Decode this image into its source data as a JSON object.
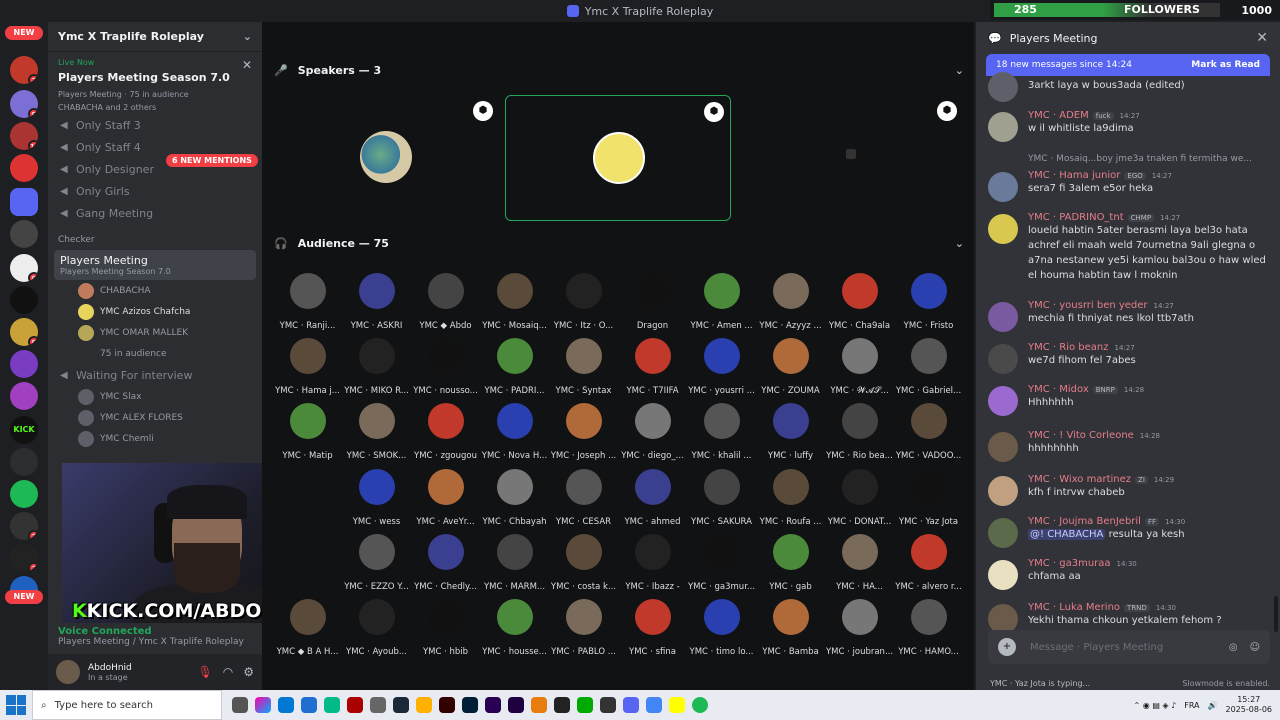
{
  "window": {
    "title": "Ymc X Traplife Roleplay"
  },
  "followers": {
    "count": "285",
    "label": "FOLLOWERS",
    "goal": "1000"
  },
  "servers": {
    "new_top": "NEW",
    "new_bottom": "NEW",
    "badges": [
      "3",
      "5",
      "11",
      "5",
      "5",
      "2",
      "3",
      "2"
    ]
  },
  "sidebar": {
    "server_name": "Ymc X Traplife Roleplay",
    "live_now": "Live Now",
    "live_title": "Players Meeting Season 7.0",
    "live_sub1": "Players Meeting · 75 in audience",
    "live_sub2": "CHABACHA and 2 others",
    "mentions": "6 NEW MENTIONS",
    "channels": [
      "Only Staff 3",
      "Only Staff 4",
      "Only Designer",
      "Only Girls",
      "Gang Meeting"
    ],
    "category": "Checker",
    "stage_name": "Players Meeting",
    "stage_sub": "Players Meeting Season 7.0",
    "stage_members": [
      "CHABACHA",
      "YMC Azizos Chafcha",
      "YMC OMAR MALLEK",
      "75 in audience"
    ],
    "waiting": "Waiting For interview",
    "waiting_members": [
      "YMC Slax",
      "YMC ALEX FLORES",
      "YMC Chemli"
    ],
    "voice_connected": "Voice Connected",
    "voice_sub": "Players Meeting / Ymc X Traplife Roleplay",
    "user": "AbdoHnid",
    "user_status": "In a stage"
  },
  "stream": {
    "kick_prefix": "K",
    "kick_url": "KICK.COM/ABDOHNID"
  },
  "stage": {
    "speakers_header": "Speakers — 3",
    "speakers_colors": [
      "#c07a5c",
      "#3b3d31",
      "#b5a658"
    ],
    "audience_header": "Audience — 75",
    "audience": [
      [
        "YMC · Ranji...",
        "YMC · ASKRI",
        "YMC ◆ Abdo",
        "YMC · Mosaiq...",
        "YMC · Itz · O...",
        "Dragon",
        "YMC · Amen ...",
        "YMC · Azyyz ...",
        "YMC · Cha9ala",
        "YMC · Fristo"
      ],
      [
        "YMC · Hama j...",
        "YMC · MIKO R...",
        "YMC · nousso...",
        "YMC · PADRI...",
        "YMC · Syntax",
        "YMC · T7IIFA",
        "YMC · yousrri ...",
        "YMC · ZOUMA",
        "YMC · 𝓦𝓐𝓢...",
        "YMC · Gabriel..."
      ],
      [
        "YMC · Matip",
        "YMC · SMOK...",
        "YMC · zgougou",
        "YMC · Nova H...",
        "YMC · Joseph ...",
        "YMC · diego_...",
        "YMC · khalil ...",
        "YMC · luffy",
        "YMC · Rio bea...",
        "YMC · VADOO..."
      ],
      [
        "YMC · wess",
        "YMC · AveYr...",
        "YMC · Chbayah",
        "YMC · CESAR",
        "YMC · ahmed",
        "YMC · SAKURA",
        "YMC · Roufa ...",
        "YMC · DONAT...",
        "YMC · Yaz Jota"
      ],
      [
        "YMC · EZZO Y...",
        "YMC · Chedly...",
        "YMC · MARM...",
        "YMC · costa k...",
        "YMC · Ibazz -",
        "YMC · ga3mur...",
        "YMC · gab",
        "YMC · HA...",
        "YMC · alvero r..."
      ],
      [
        "YMC ◆ B A H...",
        "YMC · Ayoub...",
        "YMC · hbib",
        "YMC · housse...",
        "YMC · PABLO ...",
        "YMC · sfina",
        "YMC · timo lo...",
        "YMC · Bamba",
        "YMC · joubran...",
        "YMC · HAMO..."
      ]
    ]
  },
  "chat": {
    "header": "Players Meeting",
    "new_messages": "18 new messages since 14:24",
    "mark_read": "Mark as Read",
    "messages": [
      {
        "name": "",
        "tag": "",
        "time": "",
        "text": "3arkt laya w bous3ada (edited)"
      },
      {
        "name": "YMC · ADEM",
        "tag": "fuck",
        "time": "14:27",
        "text": "w il whitliste la9dima"
      },
      {
        "name": "YMC · Hama junior",
        "tag": "EGO",
        "time": "14:27",
        "text": "sera7 fi 3alem e5or heka"
      },
      {
        "name": "YMC · PADRINO_tnt",
        "tag": "CHMP",
        "time": "14:27",
        "text": "loueld habtin 5ater berasmi laya bel3o hata achref eli maah weld 7ournetna 9ali glegna o a7na nestanew ye5i kamlou bal3ou o haw wled el houma habtin taw l moknin"
      },
      {
        "name": "YMC · yousrri ben yeder",
        "tag": "",
        "time": "14:27",
        "text": "mechia fi thniyat nes lkol ttb7ath"
      },
      {
        "name": "YMC · Rio beanz",
        "tag": "",
        "time": "14:27",
        "text": "we7d fihom fel 7abes"
      },
      {
        "name": "YMC · Midox",
        "tag": "BNRP",
        "time": "14:28",
        "text": "Hhhhhhh"
      },
      {
        "name": "YMC · ! Vito Corleone",
        "tag": "",
        "time": "14:28",
        "text": "hhhhhhhh"
      },
      {
        "name": "YMC · Wixo martinez",
        "tag": "ZI",
        "time": "14:29",
        "text": "kfh f intrvw chabeb"
      },
      {
        "name": "YMC · Joujma BenJebril",
        "tag": "FF",
        "time": "14:30",
        "text": "resulta ya kesh",
        "mention": "@! CHABACHA"
      },
      {
        "name": "YMC · ga3muraa",
        "tag": "",
        "time": "14:30",
        "text": "chfama aa"
      },
      {
        "name": "YMC · Luka Merino",
        "tag": "TRND",
        "time": "14:30",
        "text": "Yekhi thama chkoun yetkalem fehom ?"
      }
    ],
    "reply_snippet": "YMC · Mosaiq...boy jme3a tnaken fi termitha we...",
    "input_placeholder": "Message · Players Meeting",
    "typing": "YMC · Yaz Jota is typing...",
    "slowmode": "Slowmode is enabled."
  },
  "taskbar": {
    "search_placeholder": "Type here to search",
    "lang": "FRA",
    "time": "15:27",
    "date": "2025-08-06"
  }
}
